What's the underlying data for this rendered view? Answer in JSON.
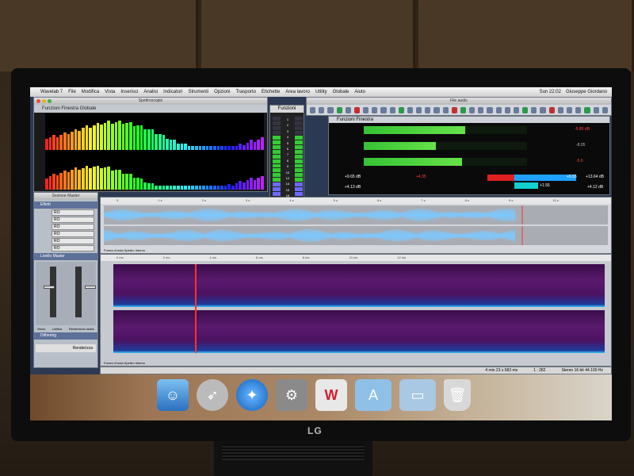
{
  "menubar": {
    "items": [
      "Wavelab 7",
      "File",
      "Modifica",
      "Vista",
      "Inserisci",
      "Analisi",
      "Indicatori",
      "Strumenti",
      "Opzioni",
      "Trasporto",
      "Etichette",
      "Area lavoro",
      "Utility",
      "Globale",
      "Aiuto"
    ],
    "clock": "Sun 22:02",
    "user": "Giuseppe Giordano"
  },
  "spectrum": {
    "title": "Spettroscopio",
    "menu": "Funzioni   Finestra   Globale"
  },
  "funzioni": {
    "title": "Funzioni",
    "scale": [
      "1",
      "2",
      "3",
      "4",
      "5",
      "6",
      "7",
      "8",
      "9",
      "10",
      "12",
      "14",
      "16",
      "18",
      "20",
      "24",
      "30",
      "36",
      "42",
      "48",
      "54",
      "60",
      "∞"
    ]
  },
  "fileaudio": {
    "title": "File audio"
  },
  "meters": {
    "menu": "Funzioni   Finestra",
    "rows": [
      {
        "ch": "1",
        "left_val": "",
        "right_val": "-5.80 dB",
        "fill": 0.62
      },
      {
        "ch": "2",
        "left_val": "",
        "right_val": "-8.05",
        "fill": 0.44
      },
      {
        "ch": "3",
        "left_val": "",
        "right_val": "-5.6",
        "fill": 0.6
      }
    ],
    "peak_left": "+9.65 dB",
    "peak_left_b": "+4.13 dB",
    "center_val": "+4.35",
    "center_val_b": "+1.55",
    "right_val_a": "+13.64 dB",
    "right_val_b": "+4.12 dB",
    "mid_val": "+5.55"
  },
  "sidepanel": {
    "title": "Sezione Master",
    "effects": "Effetti",
    "slots": [
      "RO",
      "RO",
      "RO",
      "RO",
      "RO",
      "RO"
    ],
    "level": "Livello Master",
    "dither": "Dithering",
    "render": "Renderizza",
    "bottom_labels": [
      "Mono",
      "Unifica",
      "Renderizza uscita"
    ]
  },
  "waveform": {
    "ruler": [
      "0",
      "1 s",
      "2 s",
      "3 s",
      "4 s",
      "5 s",
      "6 s",
      "7 s",
      "8 s",
      "9 s",
      "10 s"
    ],
    "tabs": "Forma d'onda   Spettro   Intorno"
  },
  "spectro": {
    "ruler": [
      "0 ms",
      "2 ms",
      "4 ms",
      "6 ms",
      "8 ms",
      "10 ms",
      "12 ms"
    ],
    "tabs": "Forma d'onda   Spettro   Intorno"
  },
  "status": {
    "pos": "4 min 23 s 683 ms",
    "ratio": "1 : 282",
    "format": "Stereo 16 bit 44.100 Hz"
  },
  "monitor": {
    "brand": "LG"
  },
  "dock": {
    "icons": [
      "finder-icon",
      "launchpad-icon",
      "safari-icon",
      "system-prefs-icon",
      "wavelab-icon",
      "applications-folder-icon",
      "documents-folder-icon",
      "trash-icon"
    ]
  }
}
